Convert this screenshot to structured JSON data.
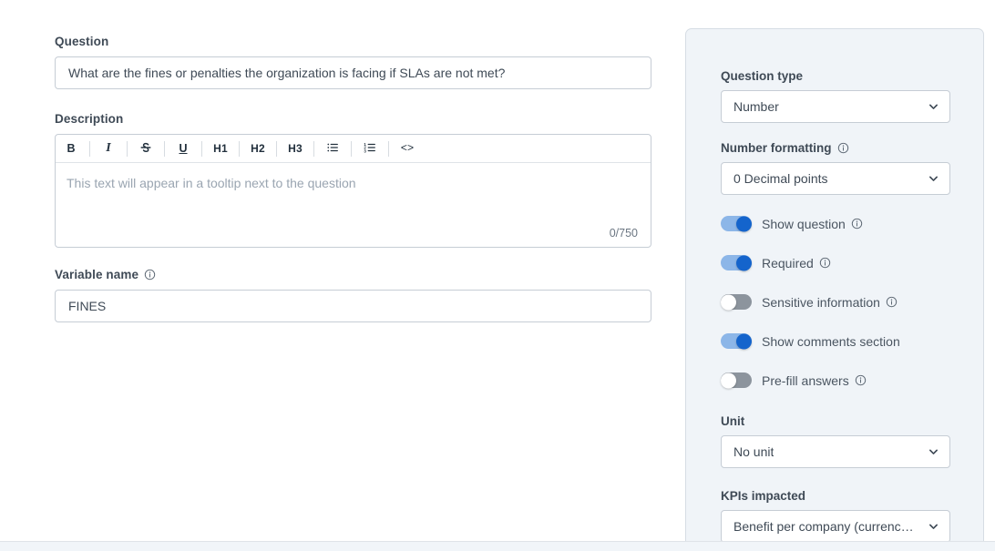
{
  "theme": {
    "panel_bg": "#f0f4f8",
    "panel_border": "#d6dde4",
    "input_border": "#c6cdd5",
    "text": "#3f4a56",
    "placeholder": "#9aa5b1",
    "toggle_on_track": "#8cb6e8",
    "toggle_on_knob": "#1464cc",
    "toggle_off_track": "#8c949d",
    "toggle_off_knob": "#ffffff"
  },
  "form": {
    "question": {
      "label": "Question",
      "value": "What are the fines or penalties the organization is facing if SLAs are not met?"
    },
    "description": {
      "label": "Description",
      "placeholder": "This text will appear in a tooltip next to the question",
      "value": "",
      "char_counter": "0/750",
      "toolbar": [
        {
          "name": "bold-button",
          "label": "B",
          "style": "bold"
        },
        {
          "name": "italic-button",
          "label": "I",
          "style": "italic"
        },
        {
          "name": "strikethrough-button",
          "label": "S",
          "style": "strike"
        },
        {
          "name": "underline-button",
          "label": "U",
          "style": "underline"
        },
        {
          "name": "heading-1-button",
          "label": "H1",
          "style": "heading"
        },
        {
          "name": "heading-2-button",
          "label": "H2",
          "style": "heading"
        },
        {
          "name": "heading-3-button",
          "label": "H3",
          "style": "heading"
        },
        {
          "name": "bullet-list-button",
          "label": "",
          "style": "icon-bullet-list"
        },
        {
          "name": "ordered-list-button",
          "label": "",
          "style": "icon-ordered-list"
        },
        {
          "name": "code-block-button",
          "label": "<>",
          "style": "code"
        }
      ]
    },
    "variable_name": {
      "label": "Variable name",
      "value": "FINES",
      "info_icon": "info-icon"
    }
  },
  "settings": {
    "question_type": {
      "label": "Question type",
      "value": "Number",
      "chevron_icon": "chevron-down-icon"
    },
    "number_formatting": {
      "label": "Number formatting",
      "value": "0 Decimal points",
      "info_icon": "info-icon",
      "chevron_icon": "chevron-down-icon"
    },
    "toggles": [
      {
        "name": "show-question",
        "label": "Show question",
        "on": true,
        "info": true
      },
      {
        "name": "required",
        "label": "Required",
        "on": true,
        "info": true
      },
      {
        "name": "sensitive-information",
        "label": "Sensitive information",
        "on": false,
        "info": true
      },
      {
        "name": "show-comments-section",
        "label": "Show comments section",
        "on": true,
        "info": false
      },
      {
        "name": "pre-fill-answers",
        "label": "Pre-fill answers",
        "on": false,
        "info": true
      }
    ],
    "unit": {
      "label": "Unit",
      "value": "No unit",
      "chevron_icon": "chevron-down-icon"
    },
    "kpis_impacted": {
      "label": "KPIs impacted",
      "value": "Benefit per company (currency/...",
      "chevron_icon": "chevron-down-icon"
    }
  }
}
